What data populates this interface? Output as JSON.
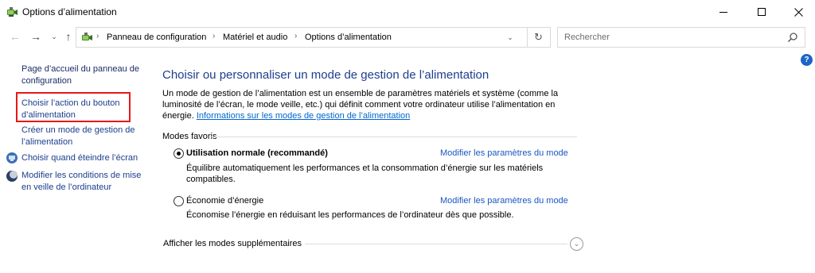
{
  "window": {
    "title": "Options d’alimentation",
    "app_icon": "power-options-icon"
  },
  "navigation": {
    "breadcrumbs": [
      "Panneau de configuration",
      "Matériel et audio",
      "Options d’alimentation"
    ],
    "search_placeholder": "Rechercher"
  },
  "sidebar": {
    "items": [
      {
        "label": "Page d’accueil du panneau de configuration"
      },
      {
        "label": "Choisir l’action du bouton d’alimentation",
        "highlighted": true
      },
      {
        "label": "Créer un mode de gestion de l’alimentation"
      },
      {
        "label": "Choisir quand éteindre l’écran",
        "icon": "monitor-icon"
      },
      {
        "label": "Modifier les conditions de mise en veille de l’ordinateur",
        "icon": "moon-icon"
      }
    ]
  },
  "main": {
    "title": "Choisir ou personnaliser un mode de gestion de l’alimentation",
    "description": "Un mode de gestion de l’alimentation est un ensemble de paramètres matériels et système (comme la luminosité de l’écran, le mode veille, etc.) qui définit comment votre ordinateur utilise l’alimentation en énergie.",
    "info_link": "Informations sur les modes de gestion de l’alimentation",
    "group_label": "Modes favoris",
    "plans": [
      {
        "name": "Utilisation normale (recommandé)",
        "selected": true,
        "change_link": "Modifier les paramètres du mode",
        "description": "Équilibre automatiquement les performances et la consommation d’énergie sur les matériels compatibles."
      },
      {
        "name": "Économie d’énergie",
        "selected": false,
        "change_link": "Modifier les paramètres du mode",
        "description": "Économise l’énergie en réduisant les performances de l’ordinateur dès que possible."
      }
    ],
    "more_label": "Afficher les modes supplémentaires"
  },
  "colors": {
    "title_blue": "#1e3d8f",
    "link_blue": "#1a56c2",
    "highlight_red": "#e8161a"
  }
}
